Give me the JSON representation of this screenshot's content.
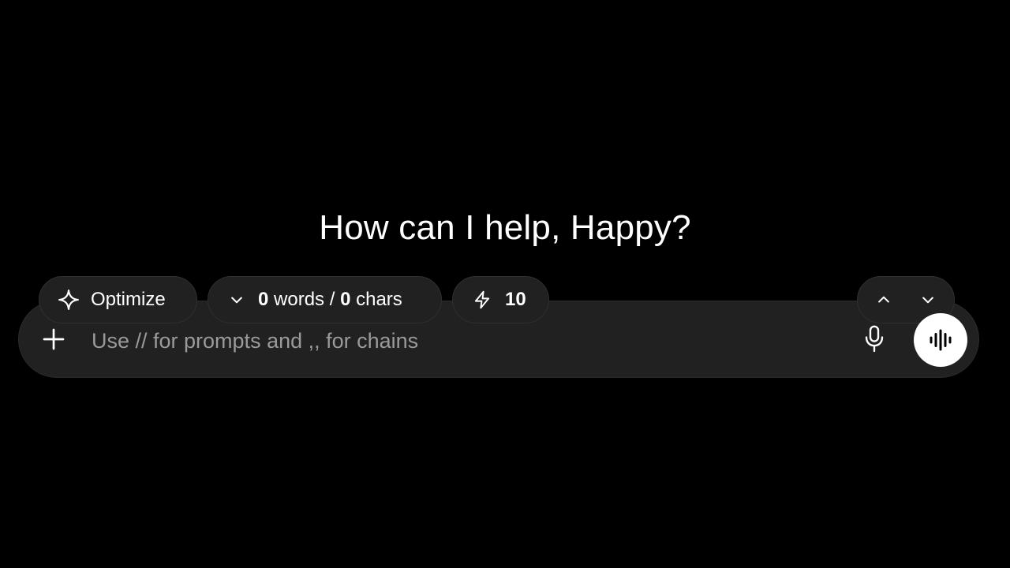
{
  "greeting": "How can I help, Happy?",
  "toolbar": {
    "optimize_label": "Optimize",
    "words_count": "0",
    "words_label": " words / ",
    "chars_count": "0",
    "chars_label": " chars",
    "credits": "10"
  },
  "composer": {
    "placeholder": "Use // for prompts and ,, for chains",
    "value": ""
  },
  "icons": {
    "optimize": "sparkle-icon",
    "count_toggle": "chevron-down-icon",
    "credits": "lightning-bolt-icon",
    "nav_up": "chevron-up-icon",
    "nav_down": "chevron-down-icon",
    "attach": "plus-icon",
    "mic": "microphone-icon",
    "voice": "waveform-icon"
  },
  "colors": {
    "background": "#000000",
    "surface": "#212121",
    "text": "#ffffff",
    "placeholder": "#9a9a9a",
    "voice_button": "#ffffff"
  }
}
